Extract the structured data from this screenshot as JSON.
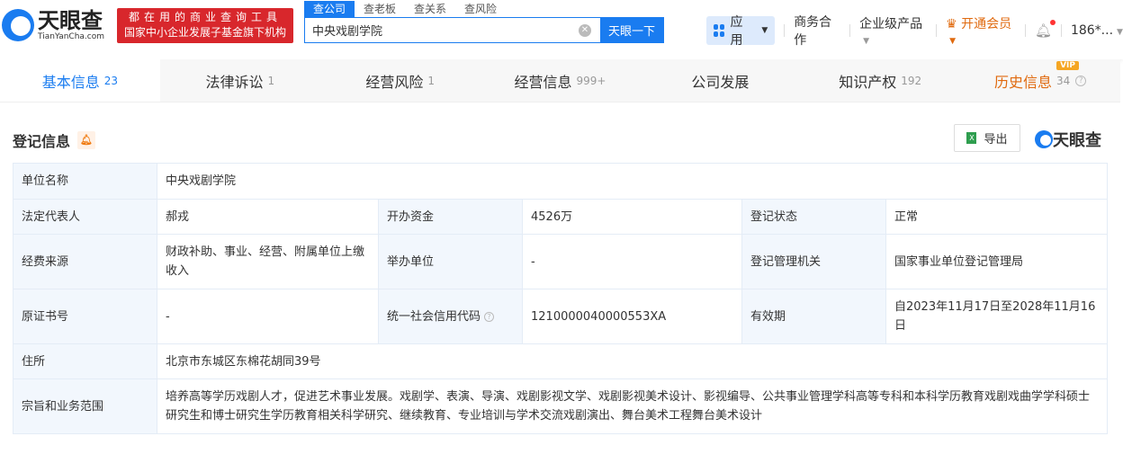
{
  "header": {
    "logo": {
      "name": "天眼查",
      "domain": "TianYanCha.com"
    },
    "slogan": [
      "都在用的商业查询工具",
      "国家中小企业发展子基金旗下机构"
    ],
    "search_tabs": [
      "查公司",
      "查老板",
      "查关系",
      "查风险"
    ],
    "search_value": "中央戏剧学院",
    "search_button": "天眼一下",
    "nav": {
      "apps": "应用",
      "business": "商务合作",
      "enterprise": "企业级产品",
      "vip": "开通会员",
      "user": "186*..."
    }
  },
  "tabs": [
    {
      "label": "基本信息",
      "count": "23"
    },
    {
      "label": "法律诉讼",
      "count": "1"
    },
    {
      "label": "经营风险",
      "count": "1"
    },
    {
      "label": "经营信息",
      "count": "999+"
    },
    {
      "label": "公司发展",
      "count": ""
    },
    {
      "label": "知识产权",
      "count": "192"
    },
    {
      "label": "历史信息",
      "count": "34",
      "badge": "VIP"
    }
  ],
  "section": {
    "title": "登记信息",
    "export": "导出",
    "brand": "天眼查"
  },
  "table": {
    "name_label": "单位名称",
    "name": "中央戏剧学院",
    "rep_label": "法定代表人",
    "rep": "郝戎",
    "fund_label": "开办资金",
    "fund": "4526万",
    "status_label": "登记状态",
    "status": "正常",
    "source_label": "经费来源",
    "source": "财政补助、事业、经营、附属单位上缴收入",
    "host_label": "举办单位",
    "host": "-",
    "authority_label": "登记管理机关",
    "authority": "国家事业单位登记管理局",
    "cert_label": "原证书号",
    "cert": "-",
    "credit_label": "统一社会信用代码",
    "credit": "1210000040000553XA",
    "valid_label": "有效期",
    "valid": "自2023年11月17日至2028年11月16日",
    "address_label": "住所",
    "address": "北京市东城区东棉花胡同39号",
    "scope_label": "宗旨和业务范围",
    "scope": "培养高等学历戏剧人才，促进艺术事业发展。戏剧学、表演、导演、戏剧影视文学、戏剧影视美术设计、影视编导、公共事业管理学科高等专科和本科学历教育戏剧戏曲学学科硕士研究生和博士研究生学历教育相关科学研究、继续教育、专业培训与学术交流戏剧演出、舞台美术工程舞台美术设计"
  },
  "colors": {
    "accent": "#1a7cf0",
    "vip": "#e06a0f",
    "slogan_bg": "#d8272c"
  }
}
